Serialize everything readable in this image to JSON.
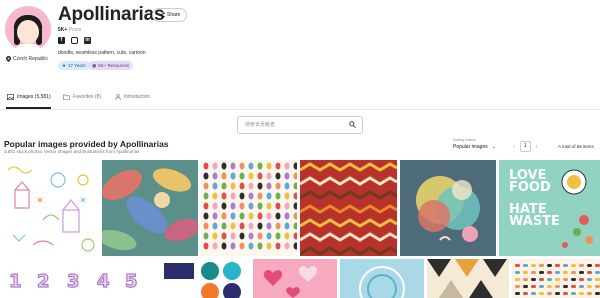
{
  "profile": {
    "name": "Apollinarias",
    "share_label": "Share",
    "followers_count": "5K+",
    "followers_label": "Posts",
    "tags": "doodle, seamless pattern, cute, cartoon",
    "location": "Czech Republic",
    "badges": [
      "17 Years",
      "5K+ Resources"
    ],
    "badge_colors": [
      "#dbeaf7",
      "#e6dbf7"
    ]
  },
  "tabs": [
    {
      "label": "Images (5,581)",
      "icon": "image-icon"
    },
    {
      "label": "Favorites (8)",
      "icon": "folder-icon"
    },
    {
      "label": "Introduction",
      "icon": "user-icon"
    }
  ],
  "search": {
    "placeholder": "搜索该贡献者"
  },
  "section": {
    "title": "Popular images provided by Apollinarias",
    "subtitle": "3,581 stock photos, vector images and illustrations from Apollinarias"
  },
  "sort": {
    "label": "Sorting criteria",
    "value": "Popular images"
  },
  "pagination": {
    "current": "1",
    "total_text": "A total of 59 items"
  },
  "gallery": {
    "row1": [
      "doodle",
      "abstract-leaves",
      "dots",
      "tribal-stripes",
      "circles",
      "love-food-hate-waste"
    ],
    "love_food": [
      "LOVE",
      "FOOD",
      "HATE",
      "WASTE"
    ]
  },
  "colors": {
    "accent": "#222222",
    "muted": "#888888"
  }
}
